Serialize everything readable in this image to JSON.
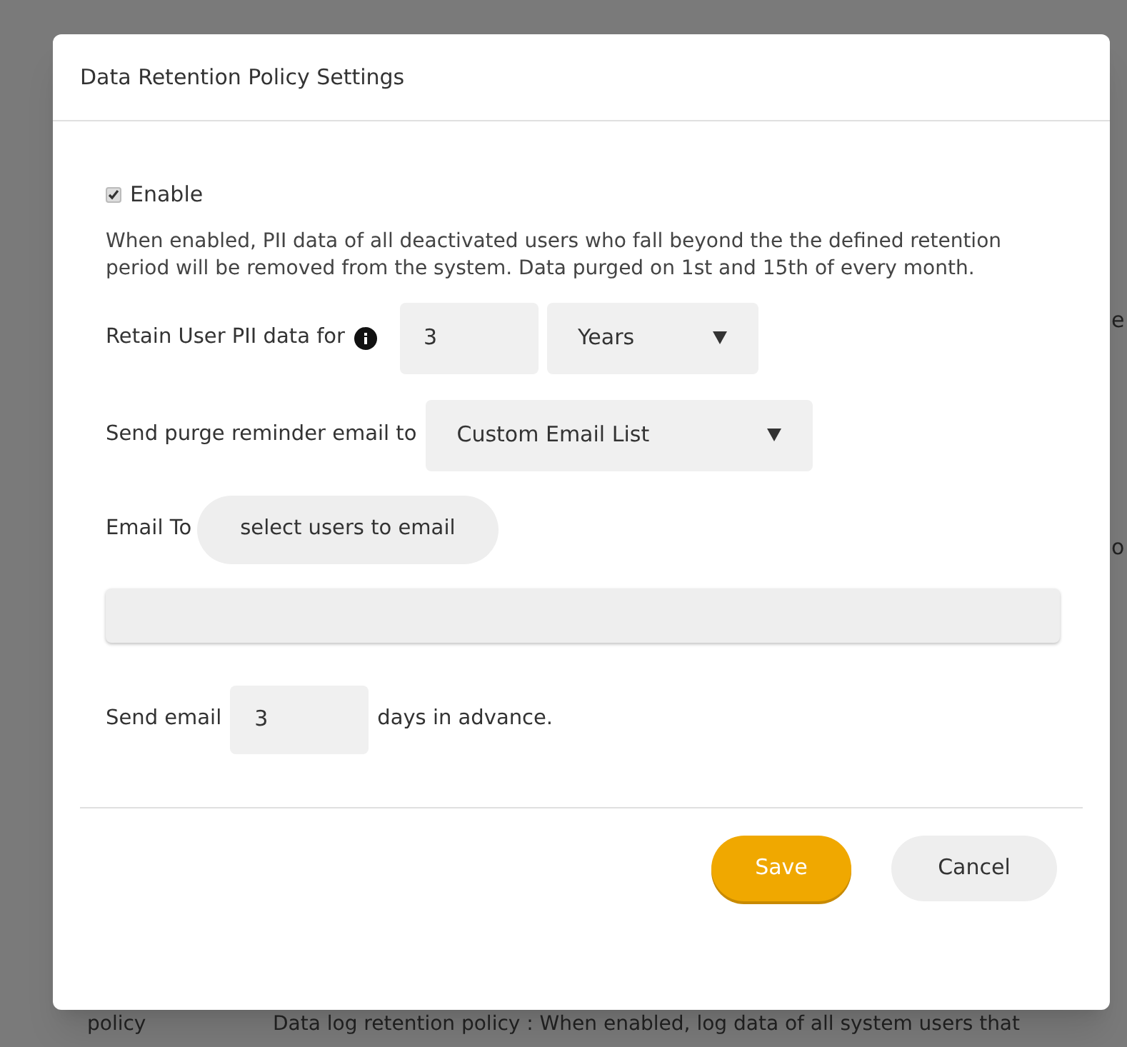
{
  "background": {
    "right_fragments": [
      "e",
      "o"
    ],
    "bottom_row": {
      "column_1": "policy",
      "column_2": "Data log retention policy : When enabled, log data of all system users that"
    }
  },
  "dialog": {
    "title": "Data Retention Policy Settings",
    "enable": {
      "label": "Enable",
      "checked": true
    },
    "description": "When enabled, PII data of all deactivated users who fall beyond the the defined retention period will be removed from the system. Data purged on 1st and 15th of every month.",
    "retain": {
      "label": "Retain User PII data for",
      "value": "3",
      "unit": "Years"
    },
    "reminder": {
      "label": "Send purge reminder email to",
      "value": "Custom Email List"
    },
    "email_to": {
      "label": "Email To",
      "button": "select users to email"
    },
    "send_email": {
      "label": "Send email",
      "value": "3",
      "suffix": "days in advance."
    },
    "buttons": [
      {
        "label": "Save",
        "kind": "primary"
      },
      {
        "label": "Cancel",
        "kind": "secondary"
      }
    ]
  }
}
